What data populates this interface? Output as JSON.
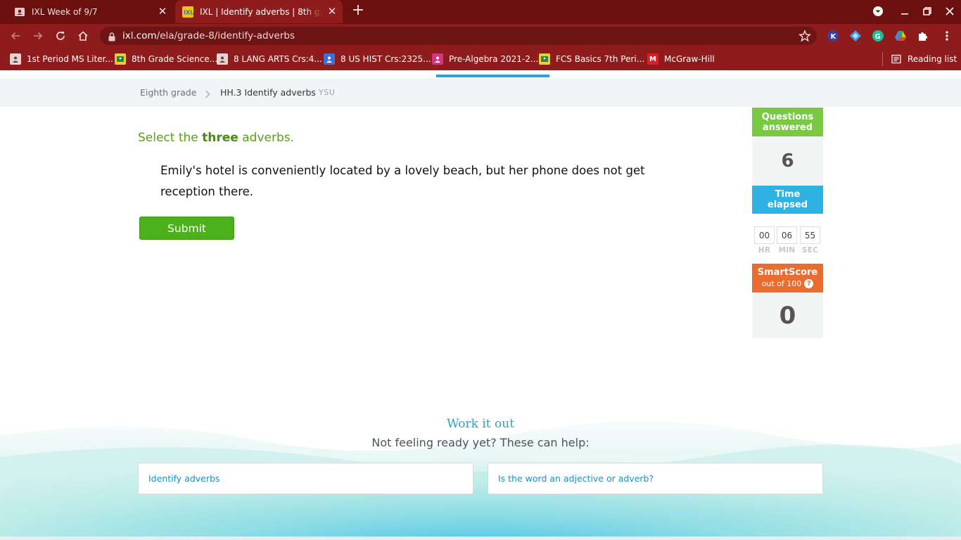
{
  "browser": {
    "tabs": [
      {
        "title": "IXL Week of 9/7",
        "active": false,
        "favicon": "classroom-assignment-icon"
      },
      {
        "title": "IXL | Identify adverbs | 8th grade",
        "active": true,
        "favicon": "ixl-favicon"
      }
    ],
    "url_host": "ixl.com",
    "url_path": "/ela/grade-8/identify-adverbs",
    "bookmarks": [
      {
        "label": "1st Period MS Liter...",
        "icon": "classroom-icon"
      },
      {
        "label": "8th Grade Science...",
        "icon": "classroom-icon"
      },
      {
        "label": "8 LANG ARTS Crs:4...",
        "icon": "classroom-icon"
      },
      {
        "label": "8 US HIST Crs:2325...",
        "icon": "classroom-icon"
      },
      {
        "label": "Pre-Algebra 2021-2...",
        "icon": "classroom-icon"
      },
      {
        "label": "FCS Basics 7th Peri...",
        "icon": "classroom-icon"
      },
      {
        "label": "McGraw-Hill",
        "icon": "mcgraw-hill-icon"
      }
    ],
    "reading_list": "Reading list",
    "colors": {
      "tabbar": "#6b0f0f",
      "toolbar": "#8e1c1c"
    }
  },
  "breadcrumb": {
    "grade": "Eighth grade",
    "skill": "HH.3 Identify adverbs",
    "code": "YSU"
  },
  "question": {
    "prompt_before": "Select the ",
    "prompt_bold": "three",
    "prompt_after": " adverbs.",
    "sentence": "Emily's hotel is conveniently located by a lovely beach, but her phone does not get reception there.",
    "submit_label": "Submit"
  },
  "stats": {
    "questions_answered_label_1": "Questions",
    "questions_answered_label_2": "answered",
    "questions_answered": "6",
    "time_label_1": "Time",
    "time_label_2": "elapsed",
    "hours": "00",
    "minutes": "06",
    "seconds": "55",
    "hr_label": "HR",
    "min_label": "MIN",
    "sec_label": "SEC",
    "smartscore_label": "SmartScore",
    "smartscore_sub": "out of 100",
    "smartscore": "0",
    "colors": {
      "questions": "#7ac943",
      "time": "#2eb2e4",
      "smartscore": "#ec6b2e"
    }
  },
  "help": {
    "title": "Work it out",
    "subtitle": "Not feeling ready yet? These can help:",
    "links": [
      "Identify adverbs",
      "Is the word an adjective or adverb?"
    ]
  }
}
